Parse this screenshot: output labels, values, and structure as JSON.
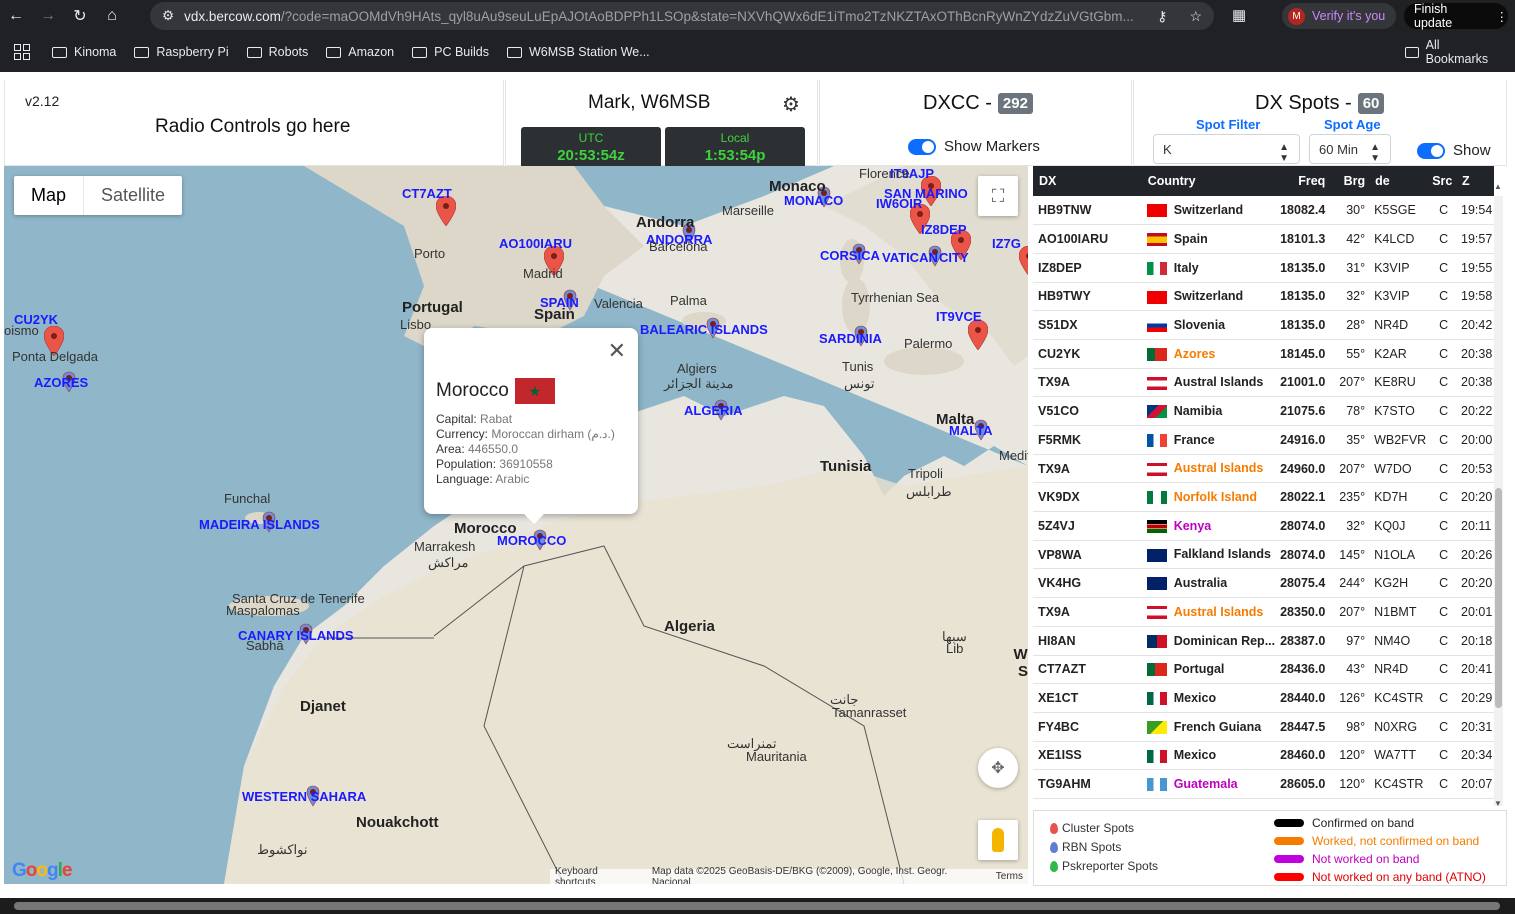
{
  "browser": {
    "url_host": "vdx.bercow.com",
    "url_rest": "/?code=maOOMdVh9HAts_qyl8uAu9seuLuEpAJOtAoBDPPh1LSOp&state=NXVhQWx6dE1iTmo2TzNKZTAxOThBcnRyWnZYdzZuVGtGbm...",
    "verify_label": "Verify it's you",
    "verify_avatar": "M",
    "finish_label": "Finish update"
  },
  "bookmarks": [
    "Kinoma",
    "Raspberry Pi",
    "Robots",
    "Amazon",
    "PC Builds",
    "W6MSB Station We..."
  ],
  "all_bookmarks": "All Bookmarks",
  "header": {
    "version": "v2.12",
    "radio_title": "Radio Controls go here",
    "operator": "Mark, W6MSB",
    "utc_label": "UTC",
    "utc_time": "20:53:54z",
    "local_label": "Local",
    "local_time": "1:53:54p",
    "dxcc_title": "DXCC -",
    "dxcc_count": "292",
    "show_markers": "Show Markers",
    "spots_title": "DX Spots -",
    "spots_count": "60",
    "spot_filter_label": "Spot Filter",
    "spot_filter_value": "K",
    "spot_age_label": "Spot Age",
    "spot_age_value": "60 Min",
    "show_label": "Show"
  },
  "map": {
    "map_btn": "Map",
    "sat_btn": "Satellite",
    "keyboard": "Keyboard shortcuts",
    "mapdata": "Map data ©2025 GeoBasis-DE/BKG (©2009), Google, Inst. Geogr. Nacional",
    "terms": "Terms",
    "logo": "Google"
  },
  "popup": {
    "country": "Morocco",
    "capital_k": "Capital:",
    "capital": "Rabat",
    "currency_k": "Currency:",
    "currency": "Moroccan dirham (د.م.)",
    "area_k": "Area:",
    "area": "446550.0",
    "pop_k": "Population:",
    "pop": "36910558",
    "lang_k": "Language:",
    "lang": "Arabic"
  },
  "columns": [
    "DX",
    "Country",
    "Freq",
    "Brg",
    "de",
    "Src",
    "Z"
  ],
  "spots": [
    {
      "dx": "HB9TNW",
      "country": "Switzerland",
      "color": "#222",
      "flag": "ch",
      "freq": "18082.4",
      "brg": "30°",
      "de": "K5SGE",
      "src": "C",
      "z": "19:54"
    },
    {
      "dx": "AO100IARU",
      "country": "Spain",
      "color": "#222",
      "flag": "es",
      "freq": "18101.3",
      "brg": "42°",
      "de": "K4LCD",
      "src": "C",
      "z": "19:57"
    },
    {
      "dx": "IZ8DEP",
      "country": "Italy",
      "color": "#222",
      "flag": "it",
      "freq": "18135.0",
      "brg": "31°",
      "de": "K3VIP",
      "src": "C",
      "z": "19:55"
    },
    {
      "dx": "HB9TWY",
      "country": "Switzerland",
      "color": "#222",
      "flag": "ch",
      "freq": "18135.0",
      "brg": "32°",
      "de": "K3VIP",
      "src": "C",
      "z": "19:58"
    },
    {
      "dx": "S51DX",
      "country": "Slovenia",
      "color": "#222",
      "flag": "si",
      "freq": "18135.0",
      "brg": "28°",
      "de": "NR4D",
      "src": "C",
      "z": "20:42"
    },
    {
      "dx": "CU2YK",
      "country": "Azores",
      "color": "#f57c00",
      "flag": "pt",
      "freq": "18145.0",
      "brg": "55°",
      "de": "K2AR",
      "src": "C",
      "z": "20:38"
    },
    {
      "dx": "TX9A",
      "country": "Austral Islands",
      "color": "#222",
      "flag": "pf",
      "freq": "21001.0",
      "brg": "207°",
      "de": "KE8RU",
      "src": "C",
      "z": "20:38"
    },
    {
      "dx": "V51CO",
      "country": "Namibia",
      "color": "#222",
      "flag": "na",
      "freq": "21075.6",
      "brg": "78°",
      "de": "K7STO",
      "src": "C",
      "z": "20:22"
    },
    {
      "dx": "F5RMK",
      "country": "France",
      "color": "#222",
      "flag": "fr",
      "freq": "24916.0",
      "brg": "35°",
      "de": "WB2FVR",
      "src": "C",
      "z": "20:00"
    },
    {
      "dx": "TX9A",
      "country": "Austral Islands",
      "color": "#f57c00",
      "flag": "pf",
      "freq": "24960.0",
      "brg": "207°",
      "de": "W7DO",
      "src": "C",
      "z": "20:53"
    },
    {
      "dx": "VK9DX",
      "country": "Norfolk Island",
      "color": "#f57c00",
      "flag": "nf",
      "freq": "28022.1",
      "brg": "235°",
      "de": "KD7H",
      "src": "C",
      "z": "20:20"
    },
    {
      "dx": "5Z4VJ",
      "country": "Kenya",
      "color": "#c000c0",
      "flag": "ke",
      "freq": "28074.0",
      "brg": "32°",
      "de": "KQ0J",
      "src": "C",
      "z": "20:11"
    },
    {
      "dx": "VP8WA",
      "country": "Falkland Islands",
      "color": "#222",
      "flag": "fk",
      "freq": "28074.0",
      "brg": "145°",
      "de": "N1OLA",
      "src": "C",
      "z": "20:26"
    },
    {
      "dx": "VK4HG",
      "country": "Australia",
      "color": "#222",
      "flag": "au",
      "freq": "28075.4",
      "brg": "244°",
      "de": "KG2H",
      "src": "C",
      "z": "20:20"
    },
    {
      "dx": "TX9A",
      "country": "Austral Islands",
      "color": "#f57c00",
      "flag": "pf",
      "freq": "28350.0",
      "brg": "207°",
      "de": "N1BMT",
      "src": "C",
      "z": "20:01"
    },
    {
      "dx": "HI8AN",
      "country": "Dominican Rep...",
      "color": "#222",
      "flag": "do",
      "freq": "28387.0",
      "brg": "97°",
      "de": "NM4O",
      "src": "C",
      "z": "20:18"
    },
    {
      "dx": "CT7AZT",
      "country": "Portugal",
      "color": "#222",
      "flag": "pt",
      "freq": "28436.0",
      "brg": "43°",
      "de": "NR4D",
      "src": "C",
      "z": "20:41"
    },
    {
      "dx": "XE1CT",
      "country": "Mexico",
      "color": "#222",
      "flag": "mx",
      "freq": "28440.0",
      "brg": "126°",
      "de": "KC4STR",
      "src": "C",
      "z": "20:29"
    },
    {
      "dx": "FY4BC",
      "country": "French Guiana",
      "color": "#222",
      "flag": "gf",
      "freq": "28447.5",
      "brg": "98°",
      "de": "N0XRG",
      "src": "C",
      "z": "20:31"
    },
    {
      "dx": "XE1ISS",
      "country": "Mexico",
      "color": "#222",
      "flag": "mx",
      "freq": "28460.0",
      "brg": "120°",
      "de": "WA7TT",
      "src": "C",
      "z": "20:34"
    },
    {
      "dx": "TG9AHM",
      "country": "Guatemala",
      "color": "#c000c0",
      "flag": "gt",
      "freq": "28605.0",
      "brg": "120°",
      "de": "KC4STR",
      "src": "C",
      "z": "20:07"
    }
  ],
  "legend": {
    "cluster": "Cluster Spots",
    "rbn": "RBN Spots",
    "psk": "Pskreporter Spots",
    "confirmed": "Confirmed on band",
    "worked": "Worked, not confirmed on band",
    "notworked": "Not worked on band",
    "atno": "Not worked on any band (ATNO)"
  },
  "map_labels": {
    "pins": [
      "CT7AZT",
      "AO100IARU",
      "ANDORRA",
      "MONACO",
      "IT9AJP",
      "SAN MARINO",
      "IW6OIR",
      "IZ8DEP",
      "IZ7G",
      "CORSICA",
      "VATICAN",
      "CITY",
      "SPAIN",
      "BALEARIC ISLANDS",
      "SARDINIA",
      "IT9VCE",
      "CU2YK",
      "AZORES",
      "ALGERIA",
      "MALTA",
      "MADEIRA ISLANDS",
      "MOROCCO",
      "CANARY ISLANDS",
      "WESTERN SAHARA"
    ],
    "places": [
      "Monaco",
      "Florence",
      "Marseille",
      "Andorra",
      "Barcelona",
      "Porto",
      "Madrid",
      "Valencia",
      "Palma",
      "Portugal",
      "Lisbo",
      "Spain",
      "Tyrrhenian Sea",
      "Palermo",
      "Tunis",
      "تونس",
      "Algiers",
      "مدينة الجزائر",
      "Ponta Delgada",
      "oismo",
      "Malta",
      "Medite",
      "Tunisia",
      "Tripoli",
      "طرابلس",
      "Funchal",
      "Morocco",
      "Marrakesh",
      "مراكش",
      "Algeria",
      "Santa Cruz de Tenerife",
      "Maspalomas",
      "Sabhā",
      "سبها",
      "Lib",
      "Western Sahara",
      "Djanet",
      "جانت",
      "Tamanrasset",
      "تمنراست",
      "Mauritania",
      "Nouakchott",
      "نواكشوط"
    ]
  }
}
